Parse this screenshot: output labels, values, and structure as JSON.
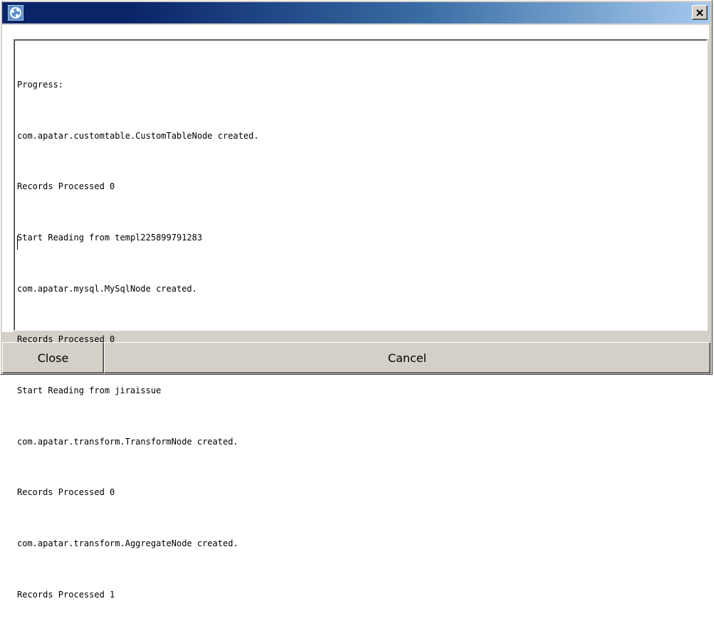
{
  "window": {
    "title": "",
    "icon": "apatar-app-icon",
    "close_icon": "close-icon",
    "close_glyph": "✕"
  },
  "log": {
    "lines": [
      "Progress:",
      "com.apatar.customtable.CustomTableNode created.",
      "Records Processed 0",
      "Start Reading from templ225899791283",
      "com.apatar.mysql.MySqlNode created.",
      "Records Processed 0",
      "Start Reading from jiraissue",
      "com.apatar.transform.TransformNode created.",
      "Records Processed 0",
      "com.apatar.transform.AggregateNode created.",
      "Records Processed 1"
    ]
  },
  "buttons": {
    "close_label": "Close",
    "cancel_label": "Cancel"
  },
  "colors": {
    "titlebar_start": "#0a246a",
    "titlebar_end": "#a6caf0",
    "face": "#d4d0c8"
  }
}
